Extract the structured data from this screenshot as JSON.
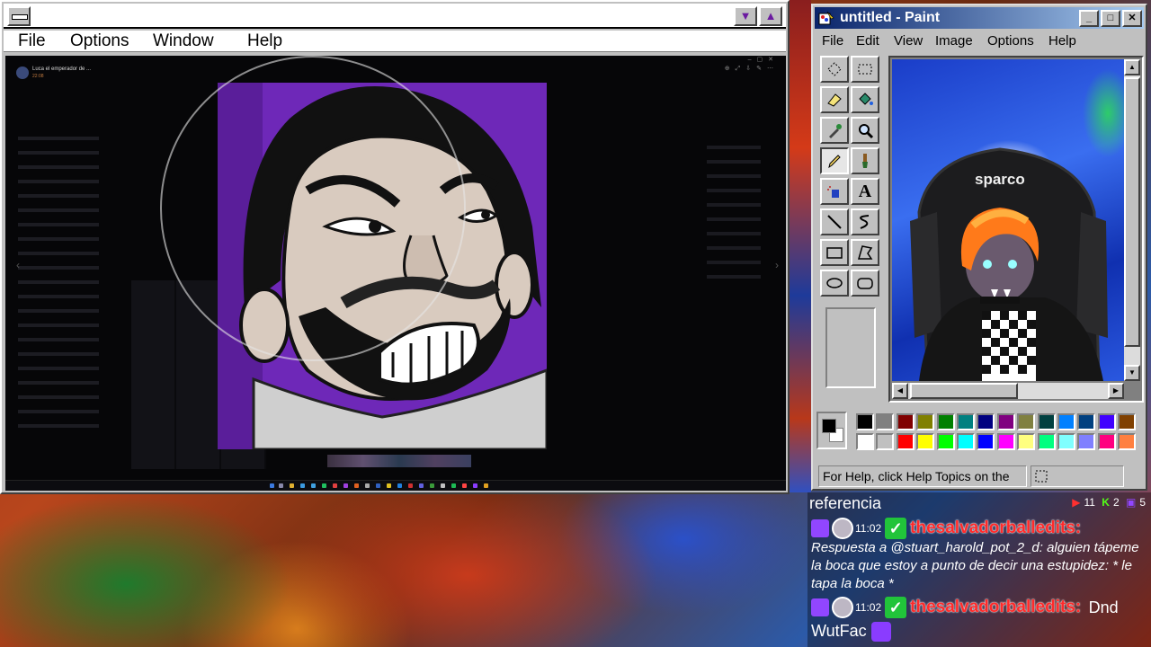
{
  "left_window": {
    "menu": [
      "File",
      "Options",
      "Window",
      "Help"
    ],
    "inner_viewer": {
      "title": "Luca el emperador de ...",
      "subtitle": "22:08"
    }
  },
  "paint": {
    "title": "untitled - Paint",
    "window_buttons": [
      "_",
      "□",
      "✕"
    ],
    "menu": [
      "File",
      "Edit",
      "View",
      "Image",
      "Options",
      "Help"
    ],
    "tools": [
      "free-select",
      "rect-select",
      "eraser",
      "fill",
      "color-picker",
      "magnifier",
      "pencil",
      "brush",
      "airbrush",
      "text",
      "line",
      "curve",
      "rectangle",
      "polygon",
      "ellipse",
      "rounded-rect"
    ],
    "selected_tool": "pencil",
    "palette_top": [
      "#000000",
      "#808080",
      "#800000",
      "#808000",
      "#008000",
      "#008080",
      "#000080",
      "#800080",
      "#808040",
      "#004040",
      "#0080ff",
      "#004080",
      "#4000ff",
      "#804000"
    ],
    "palette_bottom": [
      "#ffffff",
      "#c0c0c0",
      "#ff0000",
      "#ffff00",
      "#00ff00",
      "#00ffff",
      "#0000ff",
      "#ff00ff",
      "#ffff80",
      "#00ff80",
      "#80ffff",
      "#8080ff",
      "#ff0080",
      "#ff8040"
    ],
    "primary_color": "#000000",
    "secondary_color": "#ffffff",
    "status": "For Help, click Help Topics on the",
    "webcam_text": "sparco"
  },
  "chat": {
    "header_text": "referencia",
    "stats": {
      "youtube": "11",
      "kick": "2",
      "twitch": "5"
    },
    "messages": [
      {
        "time": "11:02",
        "user": "thesalvadorballedits:",
        "text": "Respuesta a @stuart_harold_pot_2_d: alguien tápeme la boca que estoy a punto de decir una estupidez:  * le tapa la boca *"
      },
      {
        "time": "11:02",
        "user": "thesalvadorballedits:",
        "text_inline": "Dnd",
        "text_next": "WutFac"
      }
    ]
  }
}
